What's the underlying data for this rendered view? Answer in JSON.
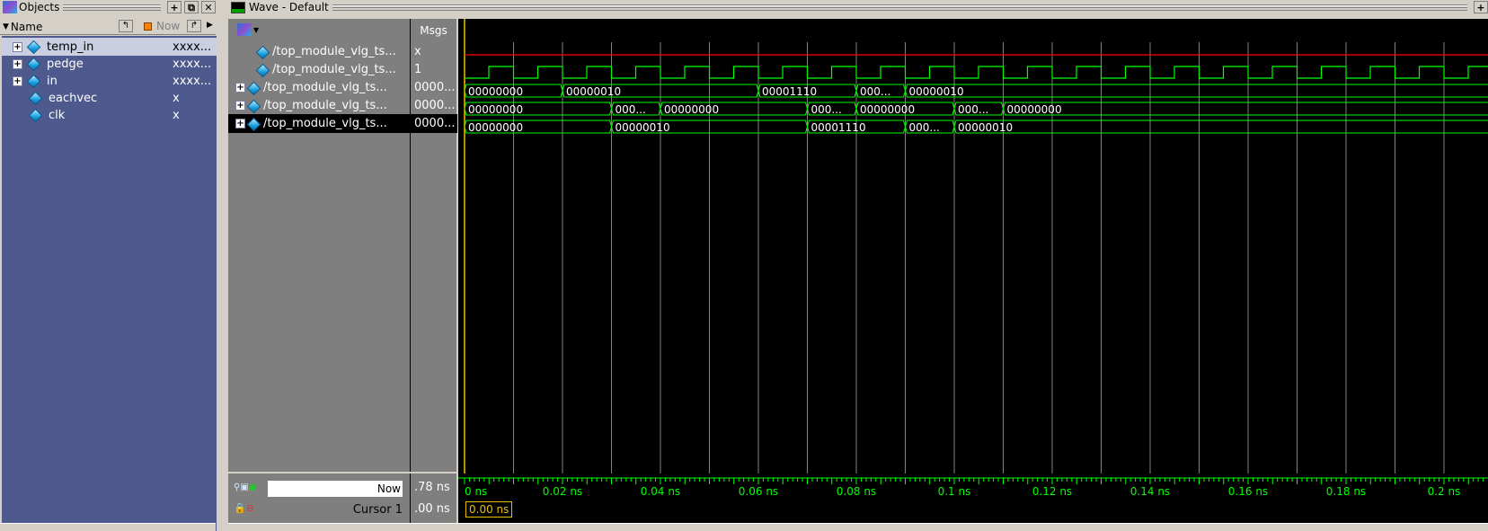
{
  "objects_pane": {
    "title": "Objects",
    "header": {
      "name": "Name",
      "now": "Now"
    },
    "items": [
      {
        "name": "temp_in",
        "value": "xxxx...",
        "expandable": true,
        "selected": true
      },
      {
        "name": "pedge",
        "value": "xxxx...",
        "expandable": true,
        "selected": false
      },
      {
        "name": "in",
        "value": "xxxx...",
        "expandable": true,
        "selected": false
      },
      {
        "name": "eachvec",
        "value": "x",
        "expandable": false,
        "selected": false
      },
      {
        "name": "clk",
        "value": "x",
        "expandable": false,
        "selected": false
      }
    ]
  },
  "wave_pane": {
    "title": "Wave - Default",
    "msgs_header": "Msgs",
    "signals": [
      {
        "name": "/top_module_vlg_ts...",
        "msg": "x",
        "expandable": false,
        "kind": "scalar_x"
      },
      {
        "name": "/top_module_vlg_ts...",
        "msg": "1",
        "expandable": false,
        "kind": "clock"
      },
      {
        "name": "/top_module_vlg_ts...",
        "msg": "0000...",
        "expandable": true,
        "kind": "bus",
        "labels": [
          "00000000",
          "00000010",
          "00001110",
          "000...",
          "00000010"
        ]
      },
      {
        "name": "/top_module_vlg_ts...",
        "msg": "0000...",
        "expandable": true,
        "kind": "bus",
        "labels": [
          "00000000",
          "000...",
          "00000000",
          "000...",
          "00000000",
          "000...",
          "00000000"
        ]
      },
      {
        "name": "/top_module_vlg_ts...",
        "msg": "0000...",
        "expandable": true,
        "kind": "bus",
        "selected": true,
        "labels": [
          "00000000",
          "00000010",
          "00001110",
          "000...",
          "00000010"
        ]
      }
    ],
    "now_label": "Now",
    "now_value": ".78 ns",
    "cursor_label": "Cursor 1",
    "cursor_value": ".00 ns",
    "cursor_readout": "0.00 ns",
    "time_ticks": [
      "0 ns",
      "0.02 ns",
      "0.04 ns",
      "0.06 ns",
      "0.08 ns",
      "0.1 ns",
      "0.12 ns",
      "0.14 ns",
      "0.16 ns",
      "0.18 ns",
      "0.2 ns"
    ]
  },
  "colors": {
    "wave_green": "#00ff00",
    "x_red": "#ff0000",
    "cursor_yellow": "#e8c000",
    "grid": "#808080"
  }
}
